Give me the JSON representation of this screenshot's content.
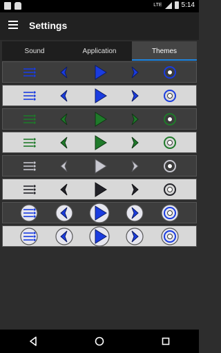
{
  "status": {
    "time": "5:14",
    "network": "LTE"
  },
  "appbar": {
    "title": "Settings"
  },
  "tabs": [
    {
      "label": "Sound",
      "active": false
    },
    {
      "label": "Application",
      "active": false
    },
    {
      "label": "Themes",
      "active": true
    }
  ],
  "themes": [
    {
      "name": "blue-dark",
      "bg": "dark",
      "color": "#1a3ce0",
      "style": "flat"
    },
    {
      "name": "blue-light",
      "bg": "light",
      "color": "#1a3ce0",
      "style": "flat"
    },
    {
      "name": "green-dark",
      "bg": "dark",
      "color": "#1f7a2a",
      "style": "flat"
    },
    {
      "name": "green-light",
      "bg": "light",
      "color": "#1f7a2a",
      "style": "flat"
    },
    {
      "name": "silver-dark",
      "bg": "dark",
      "color": "#c8c8d0",
      "style": "flat"
    },
    {
      "name": "black-light",
      "bg": "light",
      "color": "#222228",
      "style": "flat"
    },
    {
      "name": "bubble-dark",
      "bg": "dark",
      "color": "#1a3ce0",
      "style": "bubble"
    },
    {
      "name": "bubble-light",
      "bg": "light",
      "color": "#1a3ce0",
      "style": "bubble"
    }
  ],
  "icons": {
    "list": "list-icon",
    "previous": "previous-icon",
    "play": "play-icon",
    "next": "next-icon",
    "repeat": "repeat-icon"
  }
}
